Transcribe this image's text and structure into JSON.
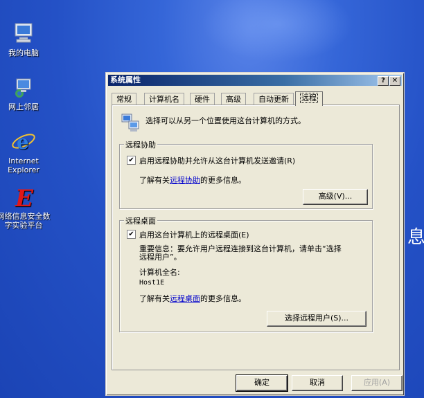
{
  "desktop": {
    "icons": [
      {
        "label": "我的电脑"
      },
      {
        "label": "网上邻居"
      },
      {
        "label": "Internet Explorer"
      },
      {
        "label": "网络信息安全数字实验平台"
      }
    ],
    "edge_glyph": "息"
  },
  "dialog": {
    "title": "系统属性",
    "help_button": "?",
    "close_button": "✕",
    "tabs": [
      "常规",
      "计算机名",
      "硬件",
      "高级",
      "自动更新",
      "远程"
    ],
    "active_tab": "远程",
    "intro": "选择可以从另一个位置使用这台计算机的方式。",
    "remote_assistance": {
      "title": "远程协助",
      "checkbox_label": "启用远程协助并允许从这台计算机发送邀请(R)",
      "checked": true,
      "info_prefix": "了解有关",
      "info_link": "远程协助",
      "info_suffix": "的更多信息。",
      "advanced_button": "高级(V)..."
    },
    "remote_desktop": {
      "title": "远程桌面",
      "checkbox_label": "启用这台计算机上的远程桌面(E)",
      "checked": true,
      "important_line1": "重要信息：要允许用户远程连接到这台计算机，请单击“选择",
      "important_line2": "远程用户”。",
      "computer_name_label": "计算机全名:",
      "computer_name": "Host1E",
      "info_prefix": "了解有关",
      "info_link": "远程桌面",
      "info_suffix": "的更多信息。",
      "select_users_button": "选择远程用户(S)..."
    },
    "footer": {
      "ok": "确定",
      "cancel": "取消",
      "apply": "应用(A)"
    }
  }
}
